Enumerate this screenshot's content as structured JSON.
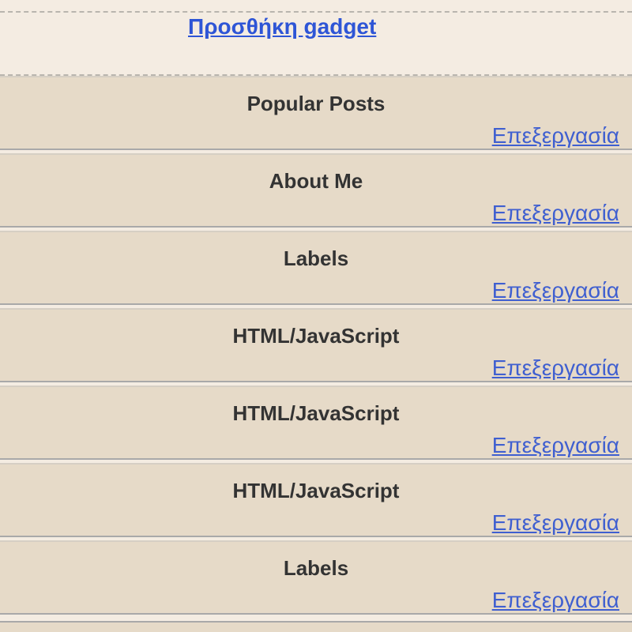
{
  "add_gadget": {
    "label": "Προσθήκη gadget"
  },
  "gadgets": [
    {
      "title": "Popular Posts",
      "edit_label": "Επεξεργασία"
    },
    {
      "title": "About Me",
      "edit_label": "Επεξεργασία"
    },
    {
      "title": "Labels",
      "edit_label": "Επεξεργασία"
    },
    {
      "title": "HTML/JavaScript",
      "edit_label": "Επεξεργασία"
    },
    {
      "title": "HTML/JavaScript",
      "edit_label": "Επεξεργασία"
    },
    {
      "title": "HTML/JavaScript",
      "edit_label": "Επεξεργασία"
    },
    {
      "title": "Labels",
      "edit_label": "Επεξεργασία"
    }
  ],
  "colors": {
    "link": "#2e55d6",
    "gadget_bg": "#e6dac8",
    "page_bg": "#f4ece2"
  }
}
